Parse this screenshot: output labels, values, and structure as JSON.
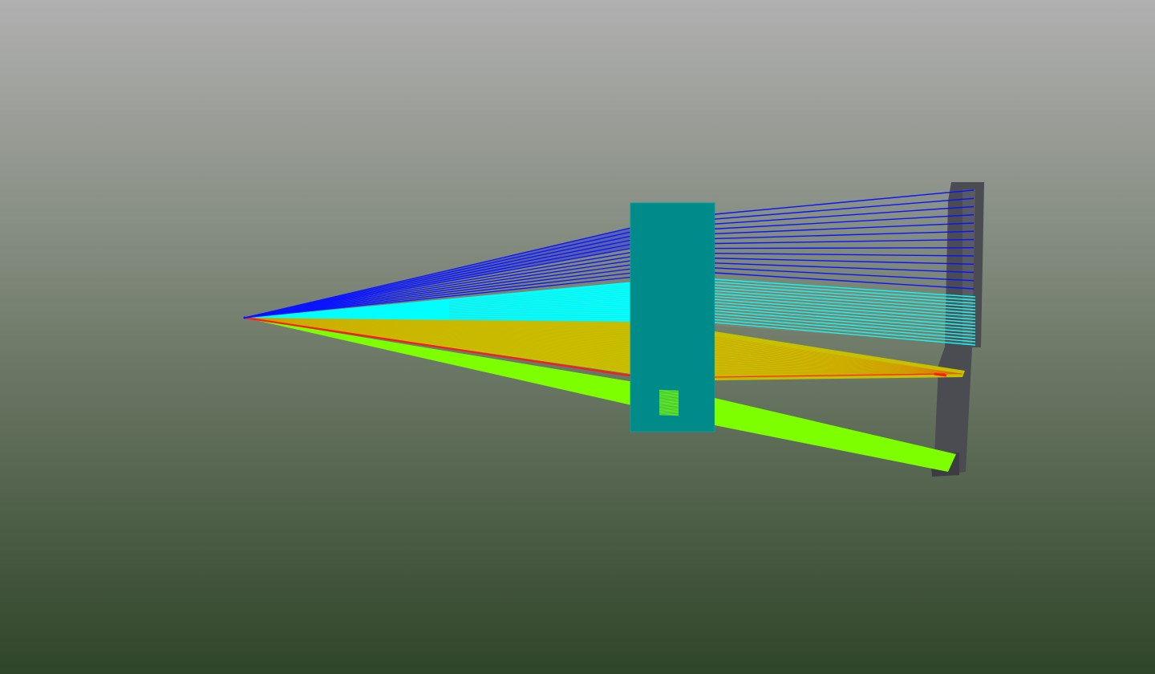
{
  "scene": {
    "background": {
      "top_color": "#b0b0b0",
      "middle_color": "#788272",
      "bottom_color": "#2f4529"
    },
    "ray_bundles": [
      {
        "name": "blue",
        "color": "#0a14ff",
        "ray_count": 13
      },
      {
        "name": "cyan",
        "color": "#00ffff",
        "ray_count": 16
      },
      {
        "name": "yellow",
        "color": "#c7c000",
        "ray_count": 40
      },
      {
        "name": "green",
        "color": "#7dff00",
        "ray_count": 40
      }
    ],
    "highlight_ray_color": "#ff1a1a",
    "lens_color": "#008b8b",
    "detector_color": "#4b4b52"
  }
}
